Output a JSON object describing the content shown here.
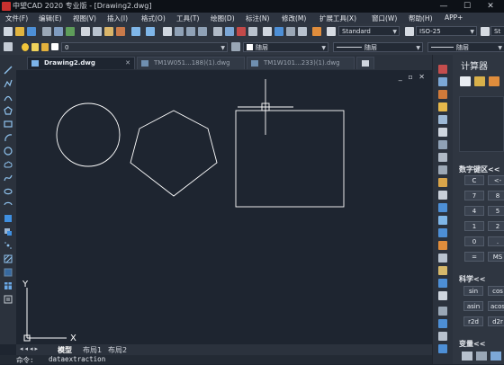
{
  "title_bar": {
    "title": "中望CAD 2020 专业版 - [Drawing2.dwg]",
    "minimize": "—",
    "maximize": "☐",
    "close": "✕"
  },
  "menu": [
    "文件(F)",
    "编辑(E)",
    "视图(V)",
    "插入(I)",
    "格式(O)",
    "工具(T)",
    "绘图(D)",
    "标注(N)",
    "修改(M)",
    "扩展工具(X)",
    "窗口(W)",
    "帮助(H)",
    "APP+"
  ],
  "toolbar": {
    "text_style": "Standard",
    "dim_style": "ISO-25",
    "overflow_label": "St",
    "layer": "0",
    "color": "随层",
    "linetype": "随层",
    "lineweight": "随层"
  },
  "tabs": [
    {
      "label": "Drawing2.dwg"
    },
    {
      "label": "TM1W051...188)(1).dwg"
    },
    {
      "label": "TM1W101...233)(1).dwg"
    }
  ],
  "view_controls": "_ ▫ ✕",
  "layout_tabs": [
    "模型",
    "布局1",
    "布局2"
  ],
  "command_line": {
    "prompt": "命令:",
    "text": "dataextraction"
  },
  "ucs": {
    "x": "X",
    "y": "Y"
  },
  "calculator": {
    "title": "计算器",
    "numpad_header": "数字键区<<",
    "numpad": [
      "C",
      "<-",
      "7",
      "8",
      "4",
      "5",
      "1",
      "2",
      "0",
      ".",
      "=",
      "MS"
    ],
    "sci_header": "科学<<",
    "sci": [
      "sin",
      "cos",
      "asin",
      "acos",
      "r2d",
      "d2r"
    ],
    "var_header": "变量<<"
  },
  "colors": {
    "canvas": "#1e2530",
    "panel": "#2b323d",
    "shape_stroke": "#ffffff",
    "accent_blue": "#3f8fe0"
  }
}
